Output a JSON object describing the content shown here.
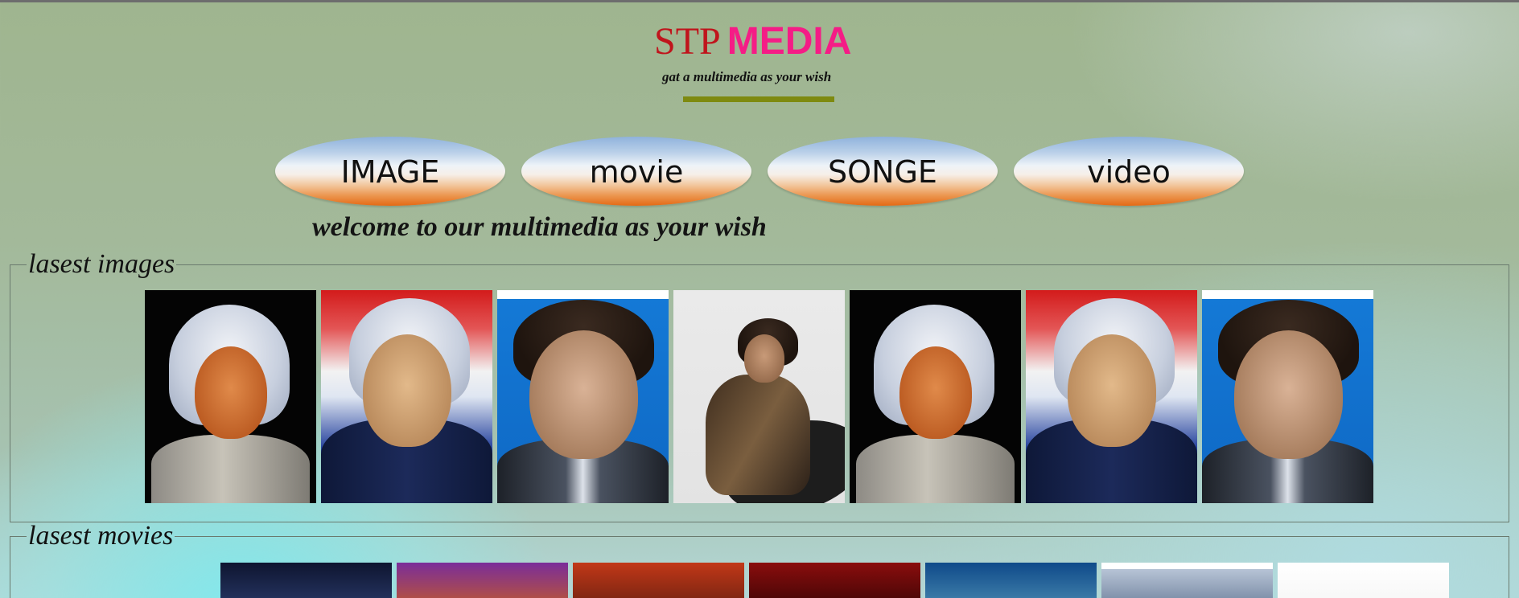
{
  "brand": {
    "part1": "STP",
    "part2": "MEDIA",
    "tagline": "gat a multimedia as your wish",
    "colors": {
      "stp": "#c0141c",
      "media": "#f51c86",
      "bar": "#7e8a10"
    }
  },
  "nav": {
    "items": [
      {
        "label": "IMAGE"
      },
      {
        "label": "movie"
      },
      {
        "label": "SONGE"
      },
      {
        "label": "video"
      }
    ]
  },
  "welcome": "welcome to our multimedia as your wish",
  "sections": {
    "images": {
      "legend": "lasest images",
      "thumbnails": [
        {
          "subject": "elderly-man-portrait",
          "style": "black-background"
        },
        {
          "subject": "elderly-man-portrait",
          "style": "flag-background"
        },
        {
          "subject": "actor-portrait",
          "style": "blue-background"
        },
        {
          "subject": "actor-leaning-pose",
          "style": "grey-background"
        },
        {
          "subject": "elderly-man-portrait",
          "style": "black-background"
        },
        {
          "subject": "elderly-man-portrait",
          "style": "flag-background"
        },
        {
          "subject": "actor-portrait",
          "style": "blue-background"
        }
      ]
    },
    "movies": {
      "legend": "lasest movies",
      "thumbnails": [
        {
          "subject": "movie-poster-1"
        },
        {
          "subject": "movie-poster-2"
        },
        {
          "subject": "movie-poster-3"
        },
        {
          "subject": "movie-poster-4"
        },
        {
          "subject": "movie-poster-5"
        },
        {
          "subject": "movie-poster-6"
        },
        {
          "subject": "movie-poster-7"
        }
      ]
    }
  }
}
